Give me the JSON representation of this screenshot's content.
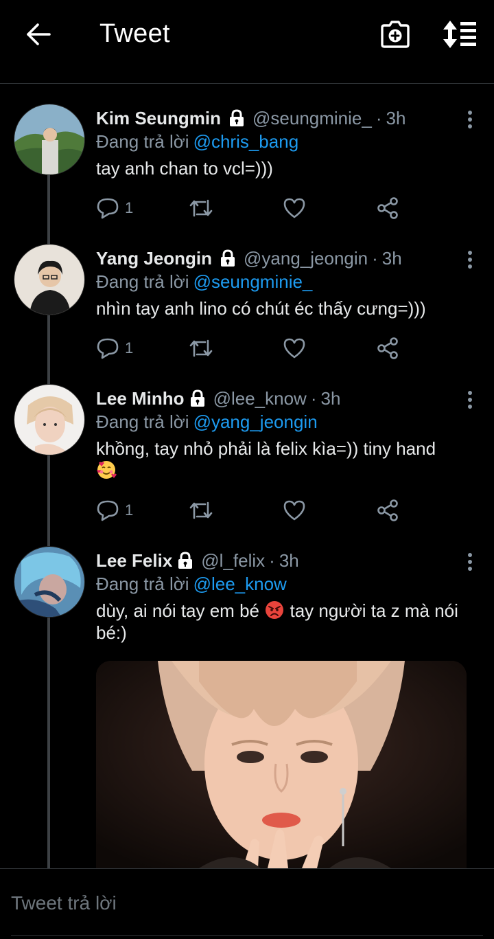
{
  "header": {
    "title": "Tweet",
    "back_icon": "arrow-left-icon",
    "camera_icon": "camera-plus-icon",
    "sort_icon": "sort-icon"
  },
  "tweets": [
    {
      "name": "Kim Seungmin",
      "handle": "@seungminie_",
      "dot": "·",
      "time": "3h",
      "reply_prefix": "Đang trả lời",
      "reply_to": "@chris_bang",
      "text": "tay anh chan to vcl=)))",
      "reply_count": "1"
    },
    {
      "name": "Yang Jeongin",
      "handle": "@yang_jeongin",
      "dot": "·",
      "time": "3h",
      "reply_prefix": "Đang trả lời",
      "reply_to": "@seungminie_",
      "text": "nhìn tay anh lino có chút éc thấy cưng=)))",
      "reply_count": "1"
    },
    {
      "name": "Lee Minho",
      "handle": "@lee_know",
      "dot": "·",
      "time": "3h",
      "reply_prefix": "Đang trả lời",
      "reply_to": "@yang_jeongin",
      "text": "khồng, tay nhỏ phải là felix kìa=)) tiny hand",
      "reply_count": "1"
    },
    {
      "name": "Lee Felix",
      "handle": "@l_felix",
      "dot": "·",
      "time": "3h",
      "reply_prefix": "Đang trả lời",
      "reply_to": "@lee_know",
      "text_before_emoji": "dùy, ai nói tay em bé",
      "text_after_emoji": "tay người ta z mà nói bé:)"
    }
  ],
  "reply_bar": {
    "placeholder": "Tweet trả lời"
  },
  "colors": {
    "background": "#000000",
    "accent": "#1d9bf0",
    "muted": "#8b98a5",
    "text": "#e7e9ea"
  }
}
